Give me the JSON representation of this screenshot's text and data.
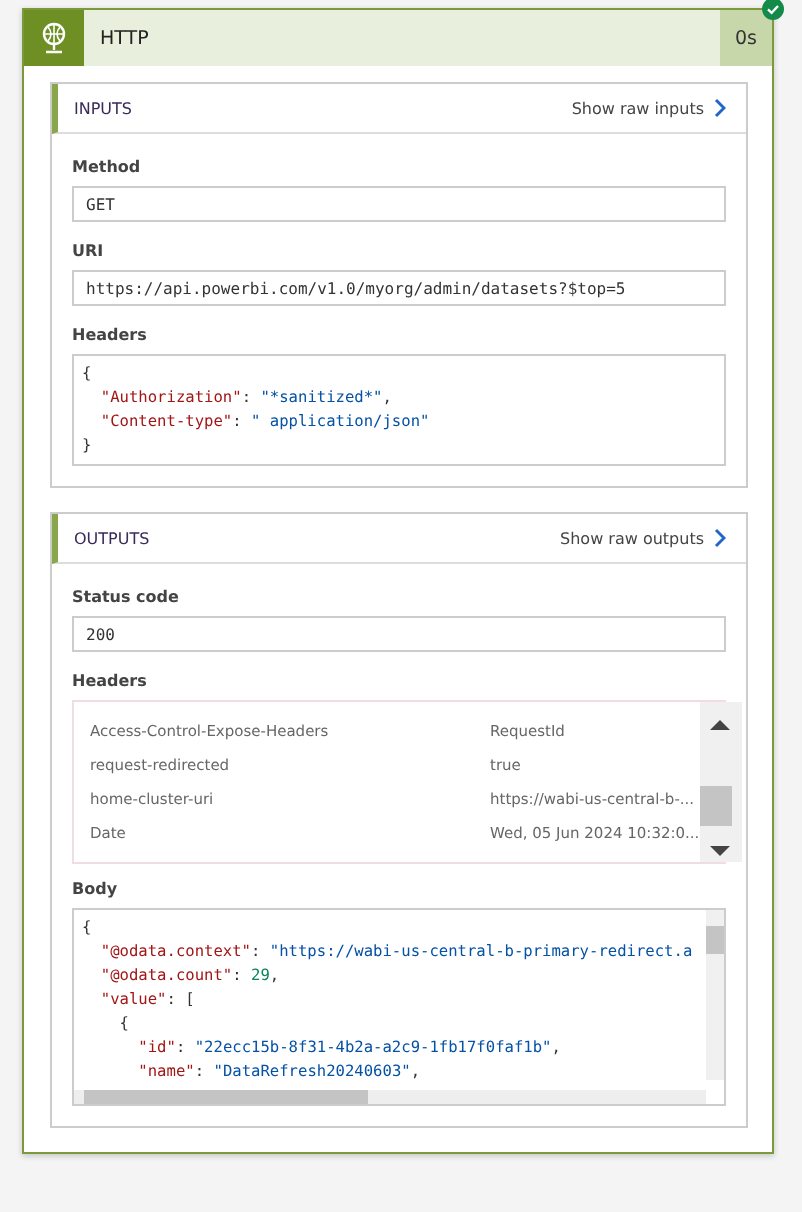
{
  "step": {
    "title": "HTTP",
    "duration": "0s",
    "succeeded": true
  },
  "sections": [
    {
      "title": "INPUTS",
      "link": "Show raw inputs",
      "fields": [
        {
          "kind": "text",
          "label": "Method",
          "value": "GET"
        },
        {
          "kind": "text",
          "label": "URI",
          "value": "https://api.powerbi.com/v1.0/myorg/admin/datasets?$top=5"
        },
        {
          "kind": "code",
          "label": "Headers",
          "lines": [
            "{",
            "  \"Authorization\": \"*sanitized*\",",
            "  \"Content-type\": \" application/json\"",
            "}"
          ]
        }
      ]
    },
    {
      "title": "OUTPUTS",
      "link": "Show raw outputs",
      "fields": [
        {
          "kind": "text",
          "label": "Status code",
          "value": "200"
        },
        {
          "kind": "table",
          "label": "Headers",
          "rows": [
            {
              "key": "Access-Control-Expose-Headers",
              "value": "RequestId"
            },
            {
              "key": "request-redirected",
              "value": "true"
            },
            {
              "key": "home-cluster-uri",
              "value": "https://wabi-us-central-b-..."
            },
            {
              "key": "Date",
              "value": "Wed, 05 Jun 2024 10:32:0..."
            }
          ]
        },
        {
          "kind": "code",
          "label": "Body",
          "lines": [
            "{",
            "  \"@odata.context\": \"https://wabi-us-central-b-primary-redirect.a",
            "  \"@odata.count\": 29,",
            "  \"value\": [",
            "    {",
            "      \"id\": \"22ecc15b-8f31-4b2a-a2c9-1fb17f0faf1b\",",
            "      \"name\": \"DataRefresh20240603\","
          ]
        }
      ]
    }
  ]
}
